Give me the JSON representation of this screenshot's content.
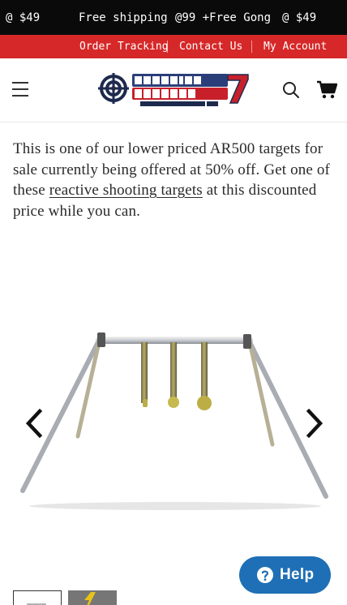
{
  "announcement_bar": {
    "items": [
      "@ $49",
      "Free shipping",
      "@99 +Free Gong",
      "@ $49"
    ]
  },
  "utility_nav": {
    "links": [
      "Order Tracking",
      "Contact Us",
      "My Account"
    ]
  },
  "header": {
    "logo_alt": "Shooting Targets 7 - Let Freedom Ring"
  },
  "product": {
    "description_before": "This is one of our lower priced AR500 targets for sale currently being offered at 50% off. Get one of these ",
    "description_link": "reactive shooting targets",
    "description_after": " at this discounted price while you can."
  },
  "gallery": {
    "current_image": "AR500 hanging gong target stand with three steel plates",
    "thumbnail_count": 2
  },
  "help_widget": {
    "label": "Help"
  },
  "colors": {
    "announcement_bg": "#0a0a0a",
    "utility_bg": "#d62828",
    "help_bg": "#1e6fb5"
  }
}
